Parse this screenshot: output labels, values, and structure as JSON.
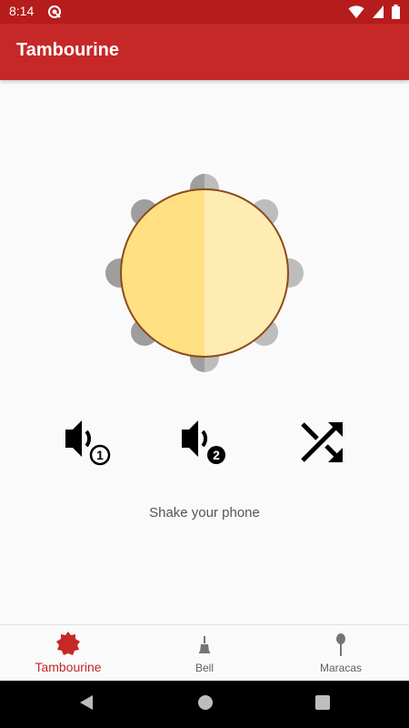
{
  "status_bar": {
    "time": "8:14"
  },
  "app_bar": {
    "title": "Tambourine"
  },
  "controls": {
    "sound1_badge": "1",
    "sound2_badge": "2"
  },
  "hint_text": "Shake your phone",
  "bottom_nav": {
    "items": [
      {
        "label": "Tambourine",
        "icon": "tambourine-icon",
        "selected": true
      },
      {
        "label": "Bell",
        "icon": "bell-icon",
        "selected": false
      },
      {
        "label": "Maracas",
        "icon": "maracas-icon",
        "selected": false
      }
    ]
  },
  "colors": {
    "status_bar": "#b71c1c",
    "app_bar": "#c62828",
    "accent": "#c62828",
    "drum_left": "#ffe082",
    "drum_right": "#ffecb3",
    "drum_rim": "#8d4a1a",
    "jingle": "#9e9e9e"
  }
}
